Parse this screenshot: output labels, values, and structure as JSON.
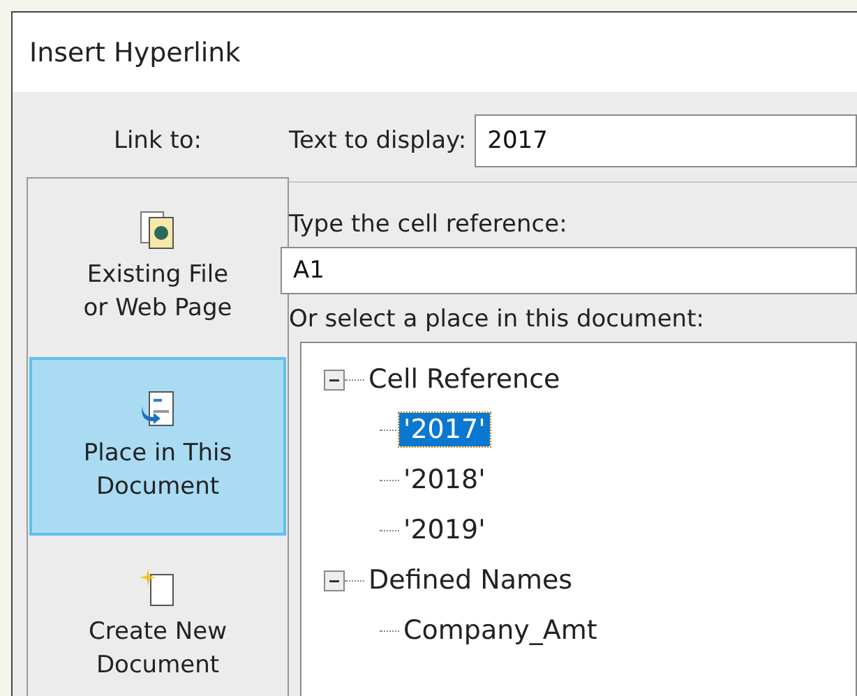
{
  "window": {
    "title": "Insert Hyperlink"
  },
  "sidebar": {
    "heading": "Link to:",
    "items": [
      {
        "kind": "file",
        "label": [
          "Existing File",
          "or Web Page"
        ],
        "selected": false
      },
      {
        "kind": "place",
        "label": [
          "Place in This",
          "Document"
        ],
        "selected": true
      },
      {
        "kind": "new",
        "label": [
          "Create New",
          "Document"
        ],
        "selected": false
      }
    ]
  },
  "text_to_display": {
    "label": "Text to display:",
    "value": "2017"
  },
  "cell_reference": {
    "label": "Type the cell reference:",
    "value": "A1"
  },
  "place_tree": {
    "label": "Or select a place in this document:",
    "nodes": [
      {
        "label": "Cell Reference",
        "expanded": true,
        "selected": false,
        "children": [
          {
            "label": "'2017'",
            "selected": true
          },
          {
            "label": "'2018'",
            "selected": false
          },
          {
            "label": "'2019'",
            "selected": false
          }
        ]
      },
      {
        "label": "Defined Names",
        "expanded": true,
        "selected": false,
        "children": [
          {
            "label": "Company_Amt",
            "selected": false
          }
        ]
      }
    ]
  }
}
